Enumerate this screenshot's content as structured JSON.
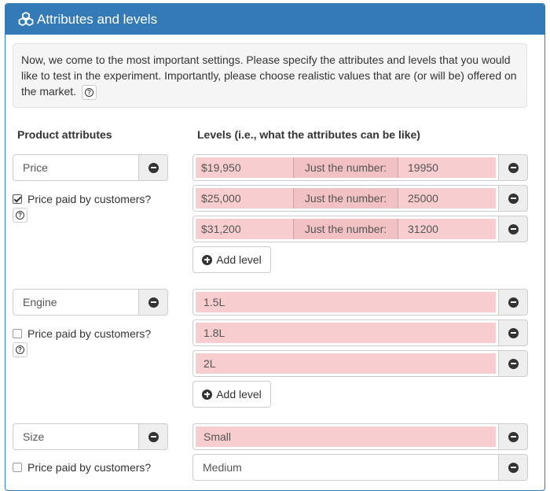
{
  "panel": {
    "title": "Attributes and levels",
    "icon": "cubes-icon",
    "accent": "#337ab7"
  },
  "intro": {
    "text": "Now, we come to the most important settings. Please specify the attributes and levels that you would like to test in the experiment. Importantly, please choose realistic values that are (or will be) offered on the market."
  },
  "columns": {
    "attributes": "Product attributes",
    "levels": "Levels (i.e., what the attributes can be like)"
  },
  "price_paid_label": "Price paid by customers?",
  "add_level_label": "Add level",
  "number_label": "Just the number:",
  "highlight_color": "#f8cdcf",
  "attributes": [
    {
      "name": "Price",
      "price_paid": true,
      "levels": [
        {
          "display": "$19,950",
          "number": "19950"
        },
        {
          "display": "$25,000",
          "number": "25000"
        },
        {
          "display": "$31,200",
          "number": "31200"
        }
      ]
    },
    {
      "name": "Engine",
      "price_paid": false,
      "levels": [
        {
          "display": "1.5L"
        },
        {
          "display": "1.8L"
        },
        {
          "display": "2L"
        }
      ]
    },
    {
      "name": "Size",
      "price_paid": false,
      "levels": [
        {
          "display": "Small"
        },
        {
          "display": "Medium"
        }
      ]
    }
  ]
}
